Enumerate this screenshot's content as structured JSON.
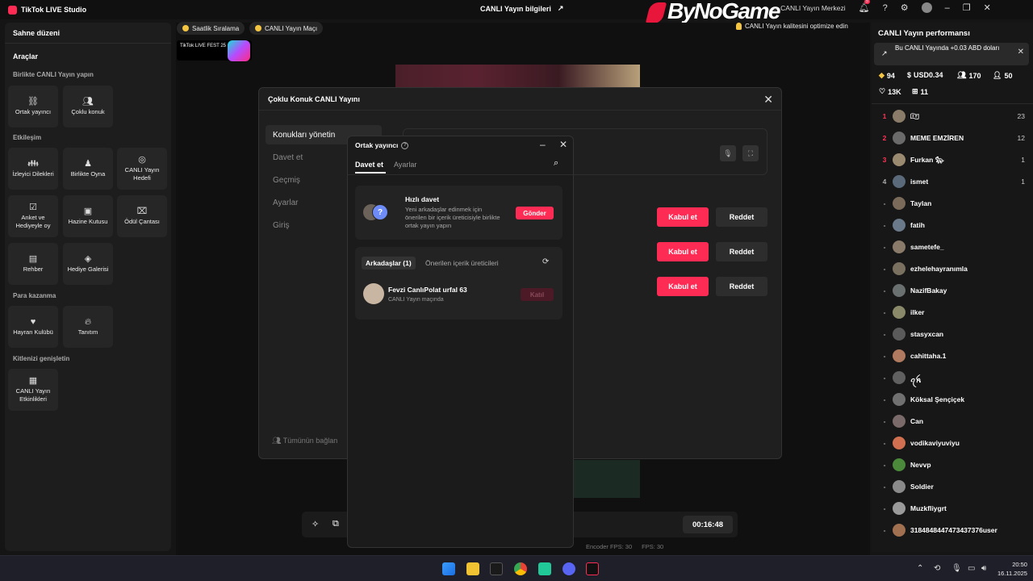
{
  "titlebar": {
    "app_name": "TikTok LIVE Studio",
    "center_title": "CANLI Yayın bilgileri",
    "center_title_icon": "share-icon",
    "watermark": "ByNoGame",
    "live_center": "CANLI Yayın Merkezi",
    "notification_count": "5"
  },
  "left_panel": {
    "scene_layout": "Sahne düzeni",
    "tools": "Araçlar",
    "section_together": "Birlikte CANLI Yayın yapın",
    "section_engagement": "Etkileşim",
    "section_monetize": "Para kazanma",
    "section_audience": "Kitlenizi genişletin",
    "tiles": [
      {
        "label": "Ortak yayıncı",
        "icon": "link-icon"
      },
      {
        "label": "Çoklu konuk",
        "icon": "users-icon"
      },
      {
        "label": "İzleyici Dilekleri",
        "icon": "people-icon"
      },
      {
        "label": "Birlikte Oyna",
        "icon": "gamepad-icon"
      },
      {
        "label": "CANLI Yayın Hedefi",
        "icon": "target-icon"
      },
      {
        "label": "Anket ve Hediyeyle oy",
        "icon": "poll-icon"
      },
      {
        "label": "Hazine Kutusu",
        "icon": "chest-icon"
      },
      {
        "label": "Ödül Çantası",
        "icon": "bag-icon"
      },
      {
        "label": "Rehber",
        "icon": "guide-icon"
      },
      {
        "label": "Hediye Galerisi",
        "icon": "gift-icon"
      },
      {
        "label": "Hayran Kulübü",
        "icon": "heart-icon"
      },
      {
        "label": "Tanıtım",
        "icon": "flame-icon"
      },
      {
        "label": "CANLI Yayın Etkinlikleri",
        "icon": "calendar-icon"
      }
    ]
  },
  "center": {
    "chip_hourly": "Saatlik Sıralama",
    "chip_match": "CANLI Yayın Maçı",
    "live_fest": "TikTok LIVE FEST 25",
    "optimize": "CANLI Yayın kalitesini optimize edin",
    "timer": "00:16:48",
    "stats": [
      "Encoder FPS: 30",
      "FPS: 30"
    ]
  },
  "modal": {
    "title": "Çoklu Konuk CANLI Yayını",
    "nav": [
      "Konukları yönetin",
      "Davet et",
      "Geçmiş",
      "Ayarlar",
      "Giriş"
    ],
    "accept": "Kabul et",
    "reject": "Reddet",
    "connect_all": "Tümünün bağlan"
  },
  "popup": {
    "title": "Ortak yayıncı",
    "tab_invite": "Davet et",
    "tab_settings": "Ayarlar",
    "quick_invite_title": "Hızlı davet",
    "quick_invite_desc": "Yeni arkadaşlar edinmek için önerilen bir içerik üreticisiyle birlikte ortak yayın yapın",
    "send": "Gönder",
    "subtab_friends": "Arkadaşlar (1)",
    "subtab_suggested": "Önerilen içerik üreticileri",
    "friend_name": "Fevzi CanlıPolat urfal 63",
    "friend_status": "CANLI Yayın maçında",
    "invite": "Katıl"
  },
  "right_panel": {
    "title": "CANLI Yayın performansı",
    "earn_text": "Bu CANLI Yayında +0.03 ABD doları",
    "stats": [
      {
        "icon": "diamond-icon",
        "value": "94"
      },
      {
        "icon": "dollar-icon",
        "value": "USD0.34"
      },
      {
        "icon": "viewers-icon",
        "value": "170"
      },
      {
        "icon": "new-follower-icon",
        "value": "50"
      },
      {
        "icon": "heart-icon",
        "value": "13K"
      },
      {
        "icon": "gift-icon",
        "value": "11"
      }
    ],
    "leaderboard": [
      {
        "rank": "1",
        "name": "🇮🇹",
        "score": "23",
        "color": "#8a7c68"
      },
      {
        "rank": "2",
        "name": "MEME EMZİREN",
        "score": "12",
        "color": "#6a6a6a"
      },
      {
        "rank": "3",
        "name": "Furkan 🐆",
        "score": "1",
        "color": "#9a8a70"
      },
      {
        "rank": "4",
        "name": "ismet",
        "score": "1",
        "color": "#5a6a7a"
      },
      {
        "rank": "-",
        "name": "Taylan",
        "score": "",
        "color": "#7a6a5a"
      },
      {
        "rank": "-",
        "name": "fatih",
        "score": "",
        "color": "#6a7a8a"
      },
      {
        "rank": "-",
        "name": "sametefe_",
        "score": "",
        "color": "#8a7a6a"
      },
      {
        "rank": "-",
        "name": "ezhelehayranımla",
        "score": "",
        "color": "#7a7060"
      },
      {
        "rank": "-",
        "name": "NazifBakay",
        "score": "",
        "color": "#6a7070"
      },
      {
        "rank": "-",
        "name": "ilker",
        "score": "",
        "color": "#8a8a6a"
      },
      {
        "rank": "-",
        "name": "stasyxcan",
        "score": "",
        "color": "#5a5a5a"
      },
      {
        "rank": "-",
        "name": "cahittaha.1",
        "score": "",
        "color": "#b07a60"
      },
      {
        "rank": "-",
        "name": "ꪖꫝ",
        "score": "",
        "color": "#606060"
      },
      {
        "rank": "-",
        "name": "Köksal Şençiçek",
        "score": "",
        "color": "#707070"
      },
      {
        "rank": "-",
        "name": "Can",
        "score": "",
        "color": "#7a6a6a"
      },
      {
        "rank": "-",
        "name": "vodikaviyuviyu",
        "score": "",
        "color": "#d07050"
      },
      {
        "rank": "-",
        "name": "Nevvp",
        "score": "",
        "color": "#4a8a3a"
      },
      {
        "rank": "-",
        "name": "Soldier",
        "score": "",
        "color": "#8a8a8a"
      },
      {
        "rank": "-",
        "name": "Muzkfliygrt",
        "score": "",
        "color": "#9a9a9a"
      },
      {
        "rank": "-",
        "name": "3184848447473437376⁨user",
        "score": "",
        "color": "#a07050"
      }
    ]
  },
  "taskbar": {
    "time": "20:50",
    "date": "16.11.2025"
  }
}
